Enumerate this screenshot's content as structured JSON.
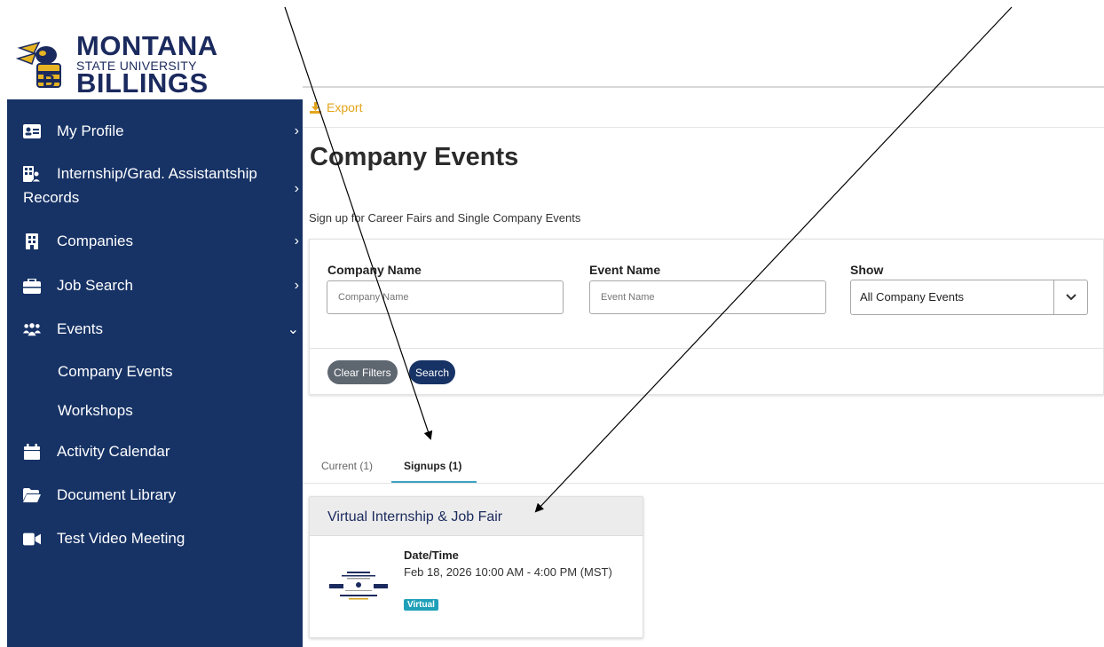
{
  "logo": {
    "line1": "MONTANA",
    "line2": "STATE UNIVERSITY",
    "line3": "BILLINGS",
    "icon": "yellowjacket-mascot"
  },
  "sidebar": {
    "items": [
      {
        "label": "My Profile",
        "icon": "id-card-icon",
        "chevron": "›"
      },
      {
        "label": "Internship/Grad. Assistantship Records",
        "icon": "building-user-icon",
        "chevron": "›"
      },
      {
        "label": "Companies",
        "icon": "building-icon",
        "chevron": "›"
      },
      {
        "label": "Job Search",
        "icon": "briefcase-icon",
        "chevron": "›"
      },
      {
        "label": "Events",
        "icon": "users-icon",
        "chevron": "⌄"
      },
      {
        "label": "Activity Calendar",
        "icon": "calendar-icon"
      },
      {
        "label": "Document Library",
        "icon": "folder-open-icon"
      },
      {
        "label": "Test Video Meeting",
        "icon": "video-icon"
      }
    ],
    "events_sub": [
      "Company Events",
      "Workshops"
    ],
    "label_line1": "Internship/Grad. Assistantship",
    "label_line2": "Records"
  },
  "toolbar": {
    "export_label": "Export"
  },
  "page": {
    "title": "Company Events",
    "subtitle": "Sign up for Career Fairs and Single Company Events"
  },
  "filters": {
    "company_label": "Company Name",
    "company_placeholder": "Company Name",
    "event_label": "Event Name",
    "event_placeholder": "Event Name",
    "show_label": "Show",
    "show_value": "All Company Events",
    "clear_label": "Clear Filters",
    "search_label": "Search"
  },
  "tabs": [
    {
      "label": "Current (1)",
      "active": false
    },
    {
      "label": "Signups (1)",
      "active": true
    }
  ],
  "event": {
    "title": "Virtual Internship & Job Fair",
    "datetime_label": "Date/Time",
    "datetime_value": "Feb 18, 2026 10:00 AM - 4:00 PM (MST)",
    "badge": "Virtual"
  },
  "colors": {
    "sidebar": "#173366",
    "accent_export": "#e3a51b",
    "tab_underline": "#3aa3c4",
    "badge": "#1fa0b8",
    "clear_button": "#5e6670"
  }
}
